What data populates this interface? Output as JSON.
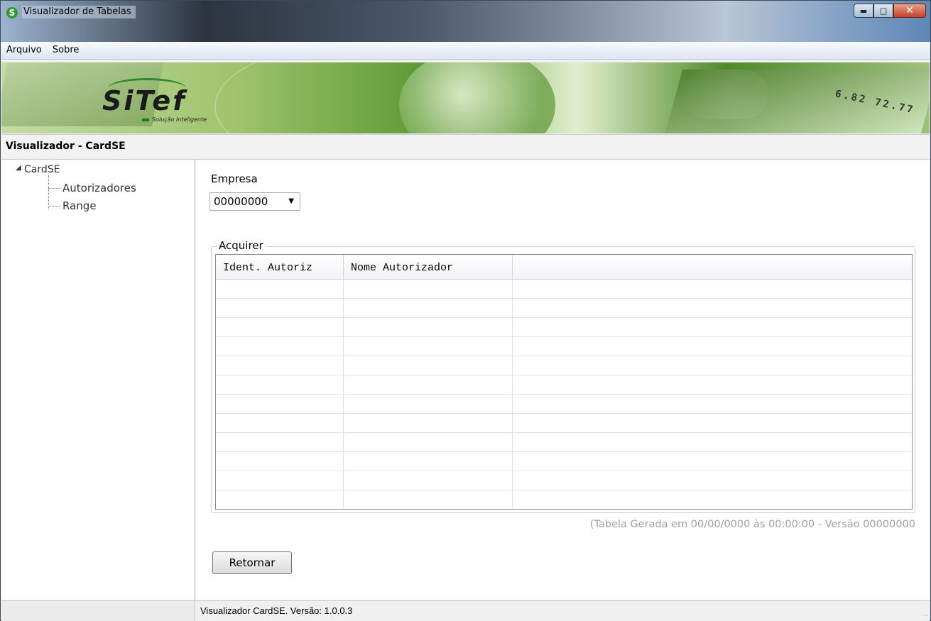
{
  "window": {
    "title": "Visualizador de Tabelas",
    "icon": "sitef-app-icon",
    "controls": [
      "minimize",
      "maximize",
      "close"
    ]
  },
  "menubar": {
    "items": [
      {
        "label": "Arquivo"
      },
      {
        "label": "Sobre"
      }
    ]
  },
  "banner": {
    "logo_text": "SiTef",
    "logo_sub": "Solução Inteligente",
    "card_digits": "6.82 72.77"
  },
  "section": {
    "title": "Visualizador - CardSE"
  },
  "tree": {
    "root": "CardSE",
    "children": [
      "Autorizadores",
      "Range"
    ]
  },
  "form": {
    "empresa_label": "Empresa",
    "empresa_value": "00000000"
  },
  "acquirer": {
    "legend": "Acquirer",
    "columns": [
      "Ident. Autoriz",
      "Nome Autorizador",
      ""
    ],
    "rows": []
  },
  "table_info": "(Tabela Gerada em 00/00/0000 às 00:00:00 - Versão 00000000",
  "buttons": {
    "retornar": "Retornar"
  },
  "statusbar": {
    "text": "Visualizador CardSE. Versão: 1.0.0.3"
  },
  "colors": {
    "accent_green": "#2e9a2e",
    "titlebar_close": "#c3432b"
  }
}
